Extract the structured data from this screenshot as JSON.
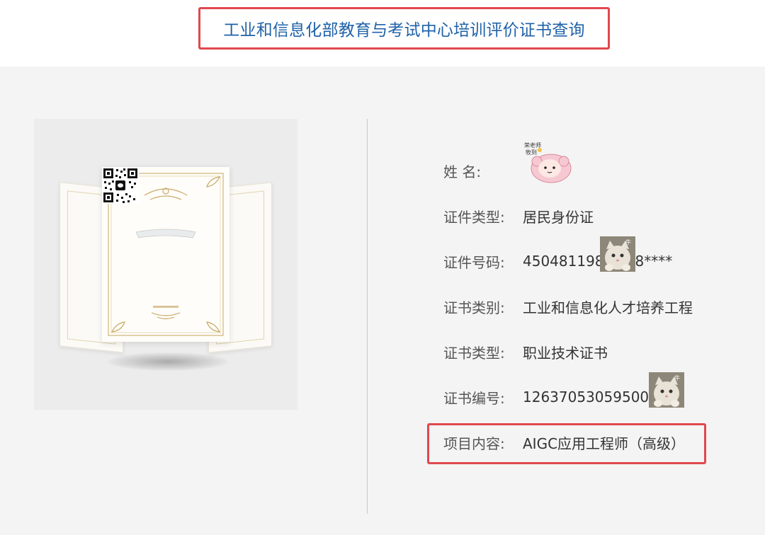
{
  "header": {
    "title": "工业和信息化部教育与考试中心培训评价证书查询"
  },
  "certificate_image": {
    "icon": "certificate-preview-icon"
  },
  "fields": [
    {
      "label": "姓      名:",
      "value": ""
    },
    {
      "label": "证件类型:",
      "value": "居民身份证"
    },
    {
      "label": "证件号码:",
      "value": "450481198",
      "value_suffix": "8****"
    },
    {
      "label": "证书类别:",
      "value": "工业和信息化人才培养工程"
    },
    {
      "label": "证书类型:",
      "value": "职业技术证书"
    },
    {
      "label": "证书编号:",
      "value": "12637053059500"
    },
    {
      "label": "项目内容:",
      "value": "AIGC应用工程师（高级）"
    }
  ],
  "stickers": {
    "name_sticker_text": "荣老师牧到"
  },
  "colors": {
    "title": "#1f62a8",
    "highlight_border": "#e0484f",
    "content_bg": "#f4f4f4"
  }
}
